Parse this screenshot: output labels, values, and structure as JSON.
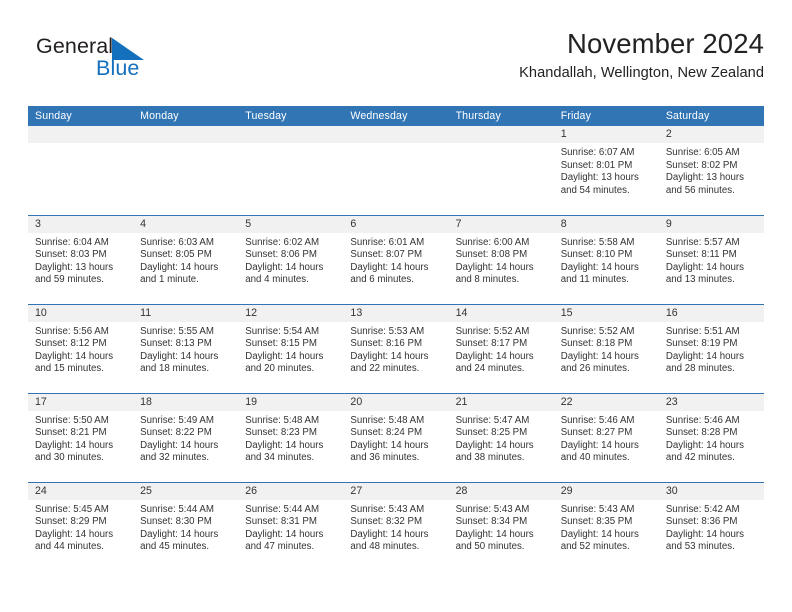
{
  "brand": {
    "name_top": "General",
    "name_bottom": "Blue",
    "triangle_icon": "blue-triangle-icon",
    "color_top": "#231f20",
    "color_bottom": "#1470bd"
  },
  "header": {
    "title": "November 2024",
    "subtitle": "Khandallah, Wellington, New Zealand"
  },
  "theme": {
    "header_blue": "#3175b4",
    "daynum_band": "#f1f1f1",
    "text": "#333333"
  },
  "calendar": {
    "weekday_headers": [
      "Sunday",
      "Monday",
      "Tuesday",
      "Wednesday",
      "Thursday",
      "Friday",
      "Saturday"
    ],
    "weeks": [
      [
        {
          "day": "",
          "empty": true
        },
        {
          "day": "",
          "empty": true
        },
        {
          "day": "",
          "empty": true
        },
        {
          "day": "",
          "empty": true
        },
        {
          "day": "",
          "empty": true
        },
        {
          "day": "1",
          "sunrise": "Sunrise: 6:07 AM",
          "sunset": "Sunset: 8:01 PM",
          "daylight": "Daylight: 13 hours and 54 minutes."
        },
        {
          "day": "2",
          "sunrise": "Sunrise: 6:05 AM",
          "sunset": "Sunset: 8:02 PM",
          "daylight": "Daylight: 13 hours and 56 minutes."
        }
      ],
      [
        {
          "day": "3",
          "sunrise": "Sunrise: 6:04 AM",
          "sunset": "Sunset: 8:03 PM",
          "daylight": "Daylight: 13 hours and 59 minutes."
        },
        {
          "day": "4",
          "sunrise": "Sunrise: 6:03 AM",
          "sunset": "Sunset: 8:05 PM",
          "daylight": "Daylight: 14 hours and 1 minute."
        },
        {
          "day": "5",
          "sunrise": "Sunrise: 6:02 AM",
          "sunset": "Sunset: 8:06 PM",
          "daylight": "Daylight: 14 hours and 4 minutes."
        },
        {
          "day": "6",
          "sunrise": "Sunrise: 6:01 AM",
          "sunset": "Sunset: 8:07 PM",
          "daylight": "Daylight: 14 hours and 6 minutes."
        },
        {
          "day": "7",
          "sunrise": "Sunrise: 6:00 AM",
          "sunset": "Sunset: 8:08 PM",
          "daylight": "Daylight: 14 hours and 8 minutes."
        },
        {
          "day": "8",
          "sunrise": "Sunrise: 5:58 AM",
          "sunset": "Sunset: 8:10 PM",
          "daylight": "Daylight: 14 hours and 11 minutes."
        },
        {
          "day": "9",
          "sunrise": "Sunrise: 5:57 AM",
          "sunset": "Sunset: 8:11 PM",
          "daylight": "Daylight: 14 hours and 13 minutes."
        }
      ],
      [
        {
          "day": "10",
          "sunrise": "Sunrise: 5:56 AM",
          "sunset": "Sunset: 8:12 PM",
          "daylight": "Daylight: 14 hours and 15 minutes."
        },
        {
          "day": "11",
          "sunrise": "Sunrise: 5:55 AM",
          "sunset": "Sunset: 8:13 PM",
          "daylight": "Daylight: 14 hours and 18 minutes."
        },
        {
          "day": "12",
          "sunrise": "Sunrise: 5:54 AM",
          "sunset": "Sunset: 8:15 PM",
          "daylight": "Daylight: 14 hours and 20 minutes."
        },
        {
          "day": "13",
          "sunrise": "Sunrise: 5:53 AM",
          "sunset": "Sunset: 8:16 PM",
          "daylight": "Daylight: 14 hours and 22 minutes."
        },
        {
          "day": "14",
          "sunrise": "Sunrise: 5:52 AM",
          "sunset": "Sunset: 8:17 PM",
          "daylight": "Daylight: 14 hours and 24 minutes."
        },
        {
          "day": "15",
          "sunrise": "Sunrise: 5:52 AM",
          "sunset": "Sunset: 8:18 PM",
          "daylight": "Daylight: 14 hours and 26 minutes."
        },
        {
          "day": "16",
          "sunrise": "Sunrise: 5:51 AM",
          "sunset": "Sunset: 8:19 PM",
          "daylight": "Daylight: 14 hours and 28 minutes."
        }
      ],
      [
        {
          "day": "17",
          "sunrise": "Sunrise: 5:50 AM",
          "sunset": "Sunset: 8:21 PM",
          "daylight": "Daylight: 14 hours and 30 minutes."
        },
        {
          "day": "18",
          "sunrise": "Sunrise: 5:49 AM",
          "sunset": "Sunset: 8:22 PM",
          "daylight": "Daylight: 14 hours and 32 minutes."
        },
        {
          "day": "19",
          "sunrise": "Sunrise: 5:48 AM",
          "sunset": "Sunset: 8:23 PM",
          "daylight": "Daylight: 14 hours and 34 minutes."
        },
        {
          "day": "20",
          "sunrise": "Sunrise: 5:48 AM",
          "sunset": "Sunset: 8:24 PM",
          "daylight": "Daylight: 14 hours and 36 minutes."
        },
        {
          "day": "21",
          "sunrise": "Sunrise: 5:47 AM",
          "sunset": "Sunset: 8:25 PM",
          "daylight": "Daylight: 14 hours and 38 minutes."
        },
        {
          "day": "22",
          "sunrise": "Sunrise: 5:46 AM",
          "sunset": "Sunset: 8:27 PM",
          "daylight": "Daylight: 14 hours and 40 minutes."
        },
        {
          "day": "23",
          "sunrise": "Sunrise: 5:46 AM",
          "sunset": "Sunset: 8:28 PM",
          "daylight": "Daylight: 14 hours and 42 minutes."
        }
      ],
      [
        {
          "day": "24",
          "sunrise": "Sunrise: 5:45 AM",
          "sunset": "Sunset: 8:29 PM",
          "daylight": "Daylight: 14 hours and 44 minutes."
        },
        {
          "day": "25",
          "sunrise": "Sunrise: 5:44 AM",
          "sunset": "Sunset: 8:30 PM",
          "daylight": "Daylight: 14 hours and 45 minutes."
        },
        {
          "day": "26",
          "sunrise": "Sunrise: 5:44 AM",
          "sunset": "Sunset: 8:31 PM",
          "daylight": "Daylight: 14 hours and 47 minutes."
        },
        {
          "day": "27",
          "sunrise": "Sunrise: 5:43 AM",
          "sunset": "Sunset: 8:32 PM",
          "daylight": "Daylight: 14 hours and 48 minutes."
        },
        {
          "day": "28",
          "sunrise": "Sunrise: 5:43 AM",
          "sunset": "Sunset: 8:34 PM",
          "daylight": "Daylight: 14 hours and 50 minutes."
        },
        {
          "day": "29",
          "sunrise": "Sunrise: 5:43 AM",
          "sunset": "Sunset: 8:35 PM",
          "daylight": "Daylight: 14 hours and 52 minutes."
        },
        {
          "day": "30",
          "sunrise": "Sunrise: 5:42 AM",
          "sunset": "Sunset: 8:36 PM",
          "daylight": "Daylight: 14 hours and 53 minutes."
        }
      ]
    ]
  }
}
